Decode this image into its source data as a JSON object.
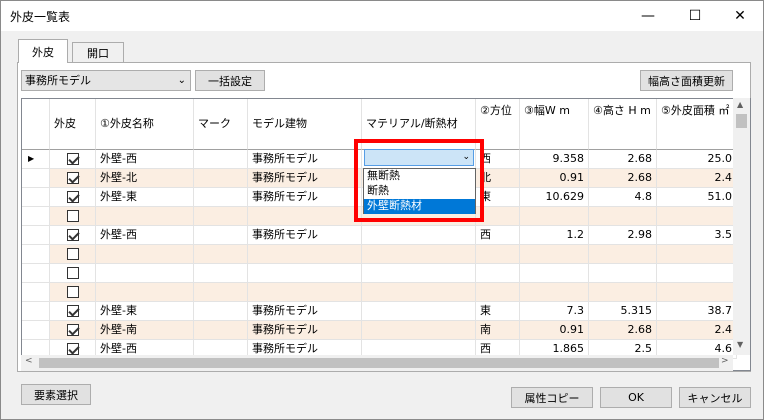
{
  "window": {
    "title": "外皮一覧表",
    "minimize_glyph": "—",
    "maximize_glyph": "☐",
    "close_glyph": "✕"
  },
  "tabs": [
    {
      "label": "外皮",
      "active": true
    },
    {
      "label": "開口",
      "active": false
    }
  ],
  "toolbar": {
    "model_select_value": "事務所モデル",
    "bulk_button": "一括設定",
    "update_button": "幅高さ面積更新"
  },
  "grid": {
    "columns": [
      "外皮",
      "①外皮名称",
      "マーク",
      "モデル建物",
      "マテリアル/断熱材",
      "②方位",
      "③幅W m",
      "④高さ H m",
      "⑤外皮面積 ㎡"
    ],
    "rows": [
      {
        "checked": true,
        "name": "外壁-西",
        "mark": "",
        "model": "事務所モデル",
        "material": "",
        "dir": "西",
        "w": "9.358",
        "h": "2.68",
        "area": "25.0"
      },
      {
        "checked": true,
        "name": "外壁-北",
        "mark": "",
        "model": "事務所モデル",
        "material": "",
        "dir": "北",
        "w": "0.91",
        "h": "2.68",
        "area": "2.4"
      },
      {
        "checked": true,
        "name": "外壁-東",
        "mark": "",
        "model": "事務所モデル",
        "material": "",
        "dir": "東",
        "w": "10.629",
        "h": "4.8",
        "area": "51.0"
      },
      {
        "checked": false,
        "name": "",
        "mark": "",
        "model": "",
        "material": "",
        "dir": "",
        "w": "",
        "h": "",
        "area": ""
      },
      {
        "checked": true,
        "name": "外壁-西",
        "mark": "",
        "model": "事務所モデル",
        "material": "",
        "dir": "西",
        "w": "1.2",
        "h": "2.98",
        "area": "3.5"
      },
      {
        "checked": false,
        "name": "",
        "mark": "",
        "model": "",
        "material": "",
        "dir": "",
        "w": "",
        "h": "",
        "area": ""
      },
      {
        "checked": false,
        "name": "",
        "mark": "",
        "model": "",
        "material": "",
        "dir": "",
        "w": "",
        "h": "",
        "area": ""
      },
      {
        "checked": false,
        "name": "",
        "mark": "",
        "model": "",
        "material": "",
        "dir": "",
        "w": "",
        "h": "",
        "area": ""
      },
      {
        "checked": true,
        "name": "外壁-東",
        "mark": "",
        "model": "事務所モデル",
        "material": "",
        "dir": "東",
        "w": "7.3",
        "h": "5.315",
        "area": "38.7"
      },
      {
        "checked": true,
        "name": "外壁-南",
        "mark": "",
        "model": "事務所モデル",
        "material": "",
        "dir": "南",
        "w": "0.91",
        "h": "2.68",
        "area": "2.4"
      },
      {
        "checked": true,
        "name": "外壁-西",
        "mark": "",
        "model": "事務所モデル",
        "material": "",
        "dir": "西",
        "w": "1.865",
        "h": "2.5",
        "area": "4.6"
      }
    ],
    "alt_row_color": "#fbeee2",
    "current_row_marker": "▶"
  },
  "dropdown": {
    "options": [
      "無断熱",
      "断熱",
      "外壁断熱材"
    ],
    "selected_index": 2,
    "arrow": "⌄"
  },
  "scroll": {
    "up": "▲",
    "down": "▼",
    "left": "<",
    "right": ">"
  },
  "footer": {
    "select_elements": "要素選択",
    "copy_attributes": "属性コピー",
    "ok": "OK",
    "cancel": "キャンセル"
  },
  "colors": {
    "highlight_box": "#ff0000",
    "selection": "#0078d7"
  }
}
